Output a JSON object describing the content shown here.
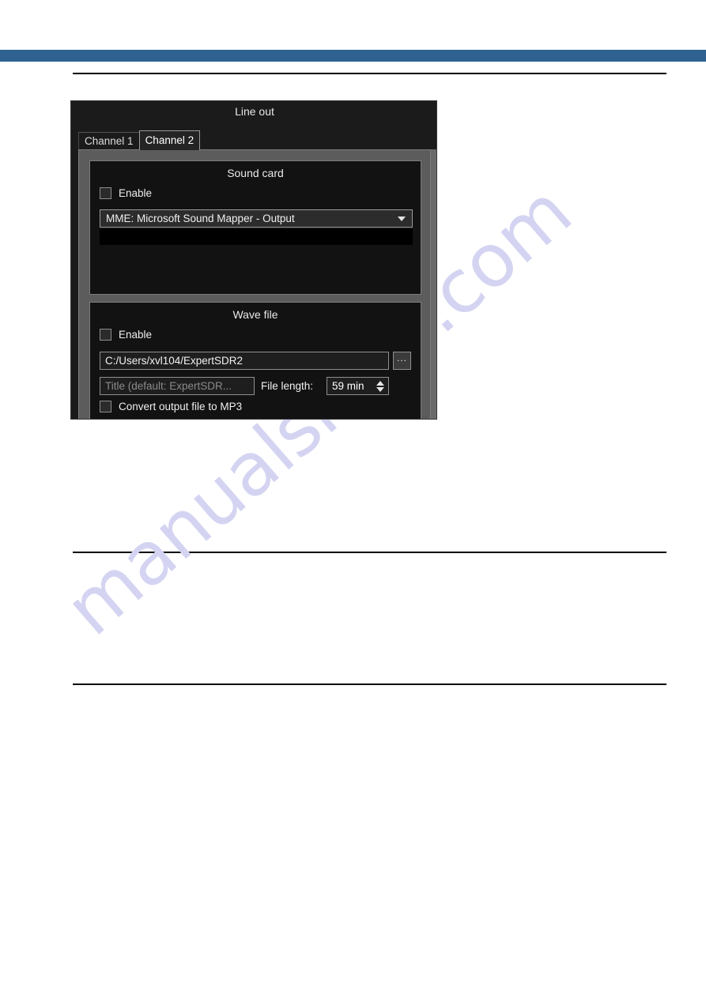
{
  "page": {
    "band_color": "#2f6291",
    "watermark_text": "manualshive.com",
    "watermark_color": "#d4d4f2"
  },
  "dialog": {
    "title": "Line out",
    "tabs": [
      {
        "label": "Channel 1",
        "active": false
      },
      {
        "label": "Channel 2",
        "active": true
      }
    ],
    "sound_card": {
      "group_title": "Sound card",
      "enable_label": "Enable",
      "enable_checked": false,
      "device_selected": "MME: Microsoft Sound Mapper - Output",
      "dropdown_icon": "chevron-down-icon"
    },
    "wave_file": {
      "group_title": "Wave file",
      "enable_label": "Enable",
      "enable_checked": false,
      "path_value": "C:/Users/xvl104/ExpertSDR2",
      "browse_label": "...",
      "title_placeholder": "Title (default: ExpertSDR...",
      "title_value": "",
      "file_length_label": "File length:",
      "file_length_value": "59 min",
      "spin_up_icon": "caret-up-icon",
      "spin_down_icon": "caret-down-icon",
      "convert_mp3_label": "Convert output file to MP3",
      "convert_mp3_checked": false
    }
  }
}
